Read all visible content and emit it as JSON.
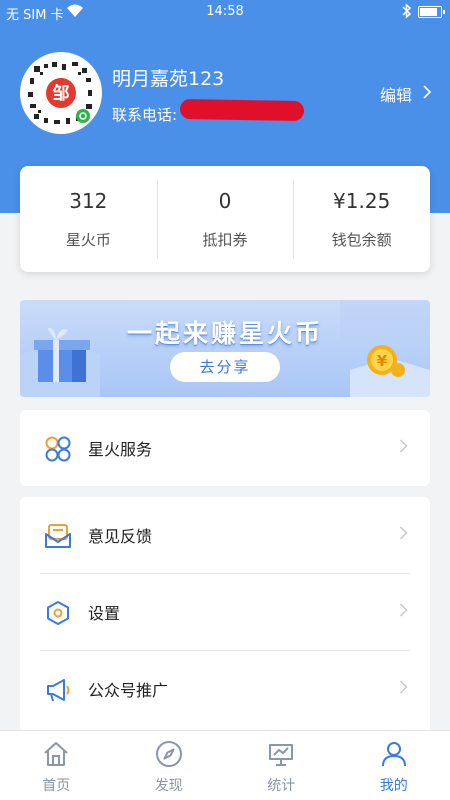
{
  "status_bar": {
    "carrier": "无 SIM 卡",
    "time": "14:58"
  },
  "profile": {
    "username": "明月嘉苑123",
    "phone_label": "联系电话:",
    "edit_label": "编辑",
    "avatar_text": "邹"
  },
  "stats": [
    {
      "value": "312",
      "label": "星火币"
    },
    {
      "value": "0",
      "label": "抵扣券"
    },
    {
      "value": "¥1.25",
      "label": "钱包余额"
    }
  ],
  "banner": {
    "title": "一起来赚星火币",
    "button_label": "去分享",
    "coin_symbol": "¥"
  },
  "menu_group_1": [
    {
      "label": "星火服务",
      "icon": "service-grid-icon"
    }
  ],
  "menu_group_2": [
    {
      "label": "意见反馈",
      "icon": "feedback-mail-icon"
    },
    {
      "label": "设置",
      "icon": "settings-hex-icon"
    },
    {
      "label": "公众号推广",
      "icon": "megaphone-icon"
    }
  ],
  "tabs": [
    {
      "label": "首页",
      "icon": "home-icon",
      "active": false
    },
    {
      "label": "发现",
      "icon": "compass-icon",
      "active": false
    },
    {
      "label": "统计",
      "icon": "stats-icon",
      "active": false
    },
    {
      "label": "我的",
      "icon": "profile-icon",
      "active": true
    }
  ],
  "colors": {
    "header_blue": "#4a90e8",
    "active_tab": "#3a7be0",
    "inactive_tab": "#8b96a6",
    "redaction": "#e0102a"
  }
}
